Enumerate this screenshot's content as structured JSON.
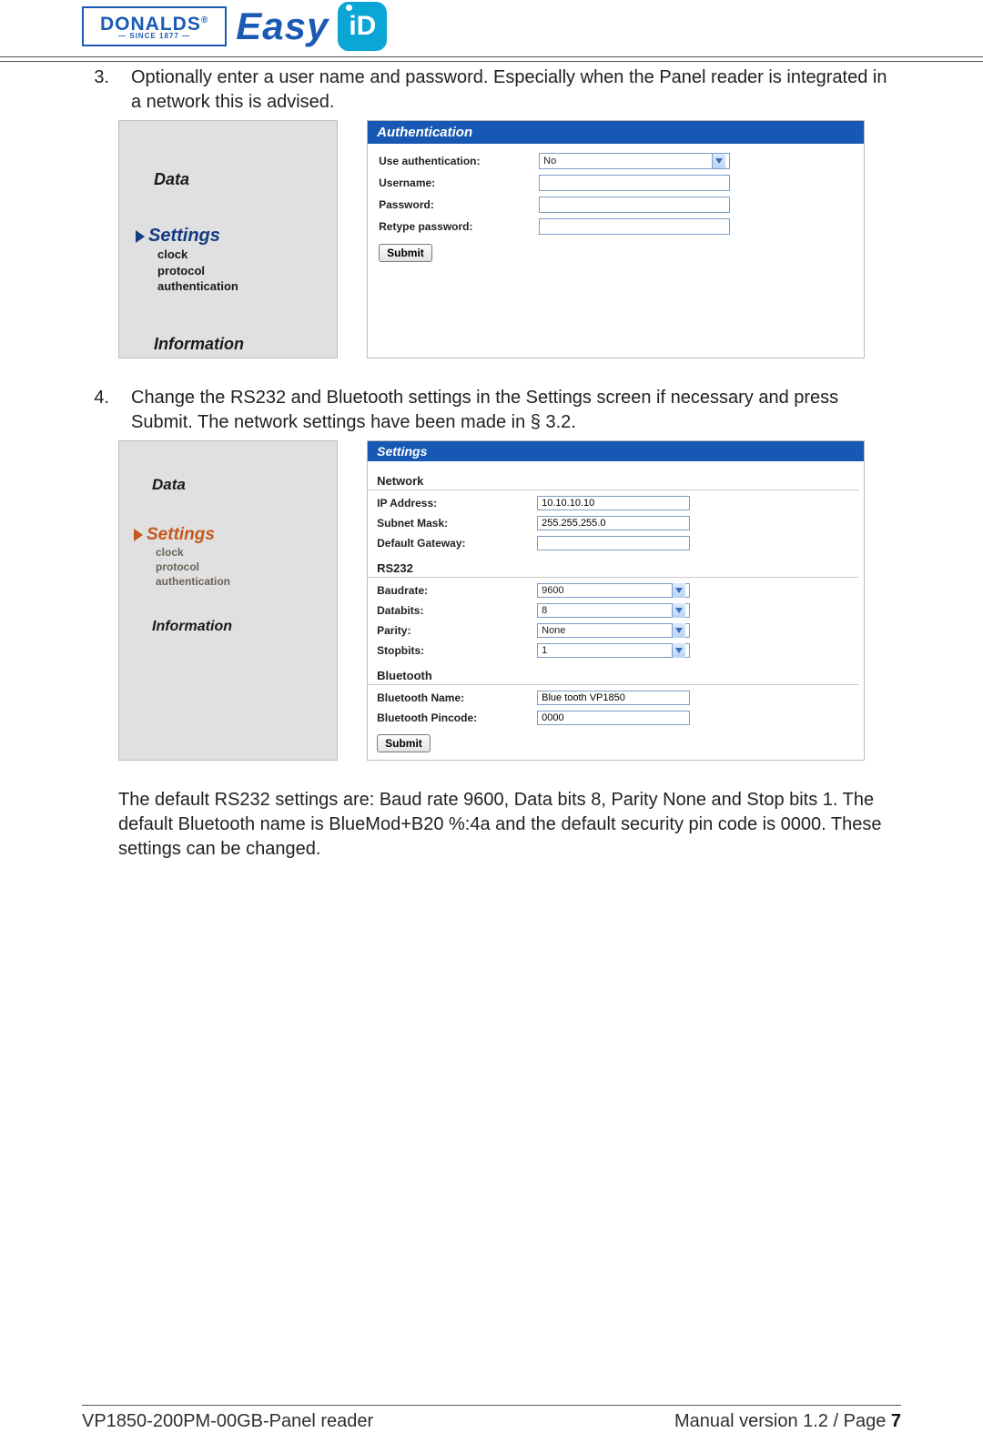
{
  "header": {
    "brand_main": "DONALDS",
    "brand_since": "— SINCE 1877 —",
    "brand_easy": "Easy",
    "brand_id": "iD"
  },
  "step3": {
    "num": "3.",
    "text": "Optionally enter a user name and password. Especially when the Panel reader is integrated in a network this is advised."
  },
  "sidebar1": {
    "data": "Data",
    "settings": "Settings",
    "sub": {
      "clock": "clock",
      "protocol": "protocol",
      "auth": "authentication"
    },
    "info": "Information"
  },
  "authPanel": {
    "title": "Authentication",
    "labels": {
      "use": "Use authentication:",
      "user": "Username:",
      "pass": "Password:",
      "repass": "Retype password:"
    },
    "useValue": "No",
    "submit": "Submit"
  },
  "step4": {
    "num": "4.",
    "text": "Change the RS232 and Bluetooth settings in the Settings screen if necessary and press Submit. The network settings have been made in § 3.2."
  },
  "sidebar2": {
    "data": "Data",
    "settings": "Settings",
    "sub": {
      "clock": "clock",
      "protocol": "protocol",
      "auth": "authentication"
    },
    "info": "Information"
  },
  "settingsPanel": {
    "title": "Settings",
    "network": {
      "heading": "Network",
      "labels": {
        "ip": "IP Address:",
        "mask": "Subnet Mask:",
        "gw": "Default Gateway:"
      },
      "values": {
        "ip": "10.10.10.10",
        "mask": "255.255.255.0",
        "gw": ""
      }
    },
    "rs232": {
      "heading": "RS232",
      "labels": {
        "baud": "Baudrate:",
        "dbits": "Databits:",
        "parity": "Parity:",
        "sbits": "Stopbits:"
      },
      "values": {
        "baud": "9600",
        "dbits": "8",
        "parity": "None",
        "sbits": "1"
      }
    },
    "bluetooth": {
      "heading": "Bluetooth",
      "labels": {
        "name": "Bluetooth Name:",
        "pin": "Bluetooth Pincode:"
      },
      "values": {
        "name": "Blue tooth VP1850",
        "pin": "0000"
      }
    },
    "submit": "Submit"
  },
  "closing": "The default RS232 settings are: Baud rate 9600, Data bits 8, Parity None and Stop bits 1. The default Bluetooth name is BlueMod+B20 %:4a and the default security pin code is 0000. These settings can be changed.",
  "footer": {
    "left": "VP1850-200PM-00GB-Panel reader",
    "right_prefix": "Manual version 1.2 / Page ",
    "page": "7"
  }
}
